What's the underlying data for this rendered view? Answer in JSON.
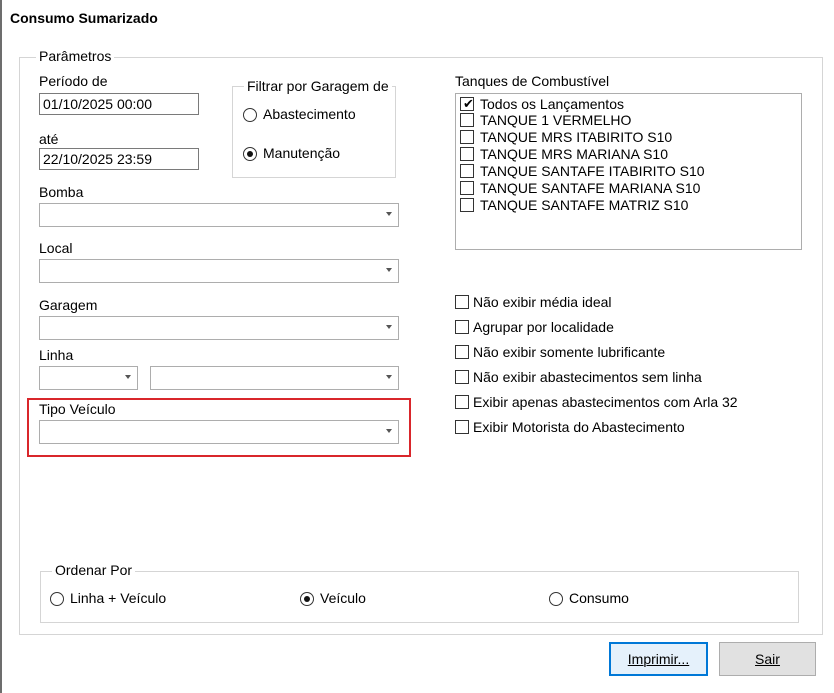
{
  "window": {
    "title": "Consumo Sumarizado"
  },
  "parametros": {
    "legend": "Parâmetros",
    "periodo_label": "Período de",
    "periodo_de": "01/10/2025 00:00",
    "ate_label": "até",
    "periodo_ate": "22/10/2025 23:59",
    "filtrar": {
      "legend": "Filtrar por Garagem de",
      "options": [
        {
          "label": "Abastecimento",
          "checked": false
        },
        {
          "label": "Manutenção",
          "checked": true
        }
      ]
    },
    "bomba_label": "Bomba",
    "local_label": "Local",
    "garagem_label": "Garagem",
    "linha_label": "Linha",
    "tipo_veiculo_label": "Tipo Veículo",
    "tanques": {
      "label": "Tanques de Combustível",
      "items": [
        {
          "label": "Todos os Lançamentos",
          "checked": true
        },
        {
          "label": "TANQUE 1 VERMELHO",
          "checked": false
        },
        {
          "label": "TANQUE MRS ITABIRITO S10",
          "checked": false
        },
        {
          "label": "TANQUE MRS MARIANA S10",
          "checked": false
        },
        {
          "label": "TANQUE SANTAFE ITABIRITO S10",
          "checked": false
        },
        {
          "label": "TANQUE SANTAFE MARIANA S10",
          "checked": false
        },
        {
          "label": "TANQUE SANTAFE MATRIZ S10",
          "checked": false
        }
      ]
    },
    "options": [
      {
        "label": "Não exibir média ideal",
        "checked": false
      },
      {
        "label": "Agrupar por localidade",
        "checked": false
      },
      {
        "label": "Não exibir somente lubrificante",
        "checked": false
      },
      {
        "label": "Não exibir abastecimentos sem linha",
        "checked": false
      },
      {
        "label": "Exibir apenas abastecimentos com Arla 32",
        "checked": false
      },
      {
        "label": "Exibir Motorista do Abastecimento",
        "checked": false
      }
    ],
    "ordenar": {
      "legend": "Ordenar Por",
      "options": [
        {
          "label": "Linha + Veículo",
          "checked": false
        },
        {
          "label": "Veículo",
          "checked": true
        },
        {
          "label": "Consumo",
          "checked": false
        }
      ]
    }
  },
  "buttons": {
    "imprimir": "Imprimir...",
    "sair": "Sair"
  },
  "colors": {
    "highlight": "#d9262b",
    "default_button_border": "#0078d7"
  }
}
